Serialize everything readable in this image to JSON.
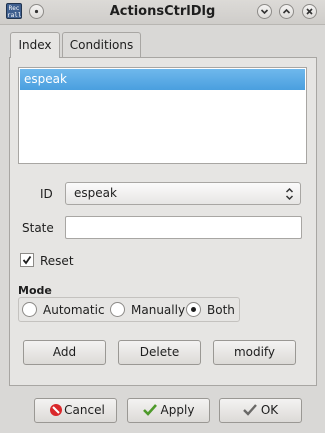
{
  "window": {
    "title": "ActionsCtrlDlg",
    "app_icon_text": "Rec rall",
    "buttons": [
      "menu-button",
      "minimize-icon",
      "maximize-icon",
      "close-icon"
    ]
  },
  "tabs": [
    {
      "label": "Index",
      "active": true
    },
    {
      "label": "Conditions",
      "active": false
    }
  ],
  "list": {
    "items": [
      {
        "label": "espeak",
        "selected": true
      }
    ]
  },
  "form": {
    "id_label": "ID",
    "id_value": "espeak",
    "state_label": "State",
    "state_value": "",
    "reset_label": "Reset",
    "reset_checked": true
  },
  "mode": {
    "title": "Mode",
    "options": [
      {
        "label": "Automatic",
        "selected": false
      },
      {
        "label": "Manually",
        "selected": false
      },
      {
        "label": "Both",
        "selected": true
      }
    ]
  },
  "actions": {
    "add": "Add",
    "delete": "Delete",
    "modify": "modify"
  },
  "dialog_buttons": {
    "cancel": "Cancel",
    "apply": "Apply",
    "ok": "OK"
  },
  "colors": {
    "selection": "#4a9fdf",
    "cancel_icon": "#d9282b",
    "check_icon": "#4e9a2a"
  }
}
